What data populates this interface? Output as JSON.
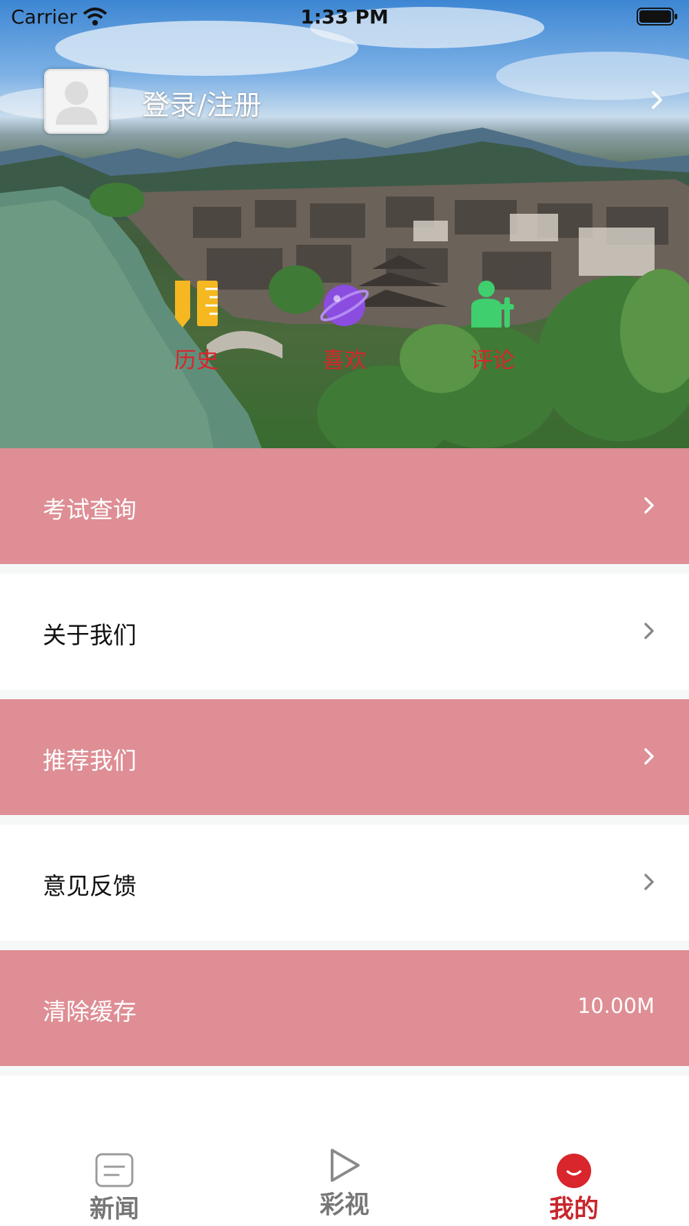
{
  "status_bar": {
    "carrier": "Carrier",
    "time": "1:33 PM"
  },
  "profile": {
    "login_label": "登录/注册",
    "avatar_icon": "user-avatar-icon",
    "chevron_icon": "chevron-right-icon"
  },
  "quick_links": [
    {
      "label": "历史",
      "icon": "history-ruler-icon",
      "color": "#f5b821"
    },
    {
      "label": "喜欢",
      "icon": "planet-icon",
      "color": "#8a4de0"
    },
    {
      "label": "评论",
      "icon": "comment-person-icon",
      "color": "#3fcf6e"
    }
  ],
  "quick_label_color": "#d8262c",
  "menu": [
    {
      "label": "考试查询",
      "style": "pink",
      "trailing": "chevron"
    },
    {
      "label": "关于我们",
      "style": "white",
      "trailing": "chevron"
    },
    {
      "label": "推荐我们",
      "style": "pink",
      "trailing": "chevron"
    },
    {
      "label": "意见反馈",
      "style": "white",
      "trailing": "chevron"
    },
    {
      "label": "清除缓存",
      "style": "pink",
      "trailing": "value",
      "value": "10.00M"
    }
  ],
  "menu_pink_color": "#de8e94",
  "tabs": [
    {
      "label": "新闻",
      "icon": "news-icon",
      "active": false
    },
    {
      "label": "彩视",
      "icon": "play-icon",
      "active": false
    },
    {
      "label": "我的",
      "icon": "profile-smile-icon",
      "active": true
    }
  ],
  "tab_active_color": "#c8262c"
}
